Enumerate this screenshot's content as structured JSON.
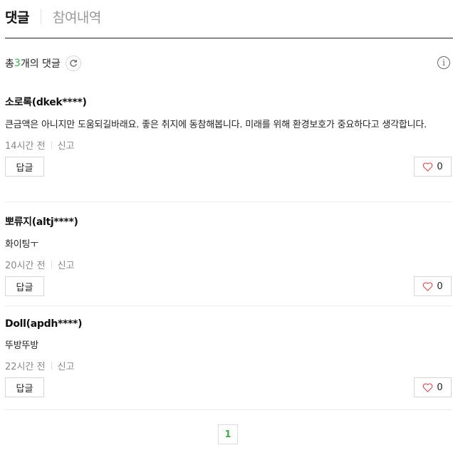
{
  "tabs": [
    {
      "label": "댓글",
      "active": true
    },
    {
      "label": "참여내역",
      "active": false
    }
  ],
  "summary": {
    "prefix": "총 ",
    "count": "3",
    "suffix": "개의 댓글"
  },
  "icons": {
    "refresh": "refresh-icon",
    "info": "info-icon",
    "heart": "heart-icon"
  },
  "colors": {
    "accent": "#3eae4c",
    "heart": "#e05a5a"
  },
  "comments": [
    {
      "author": "소로록(dkek****)",
      "text": "큰금액은 아니지만 도움되길바래요. 좋은 취지에 동참해봅니다. 미래를 위해 환경보호가 중요하다고 생각합니다.",
      "time": "14시간 전",
      "report": "신고",
      "reply": "답글",
      "likes": "0"
    },
    {
      "author": "뽀류지(altj****)",
      "text": "화이팅ㅜ",
      "time": "20시간 전",
      "report": "신고",
      "reply": "답글",
      "likes": "0"
    },
    {
      "author": "Doll(apdh****)",
      "text": "뚜방뚜방",
      "time": "22시간 전",
      "report": "신고",
      "reply": "답글",
      "likes": "0"
    }
  ],
  "pagination": {
    "current": "1"
  }
}
